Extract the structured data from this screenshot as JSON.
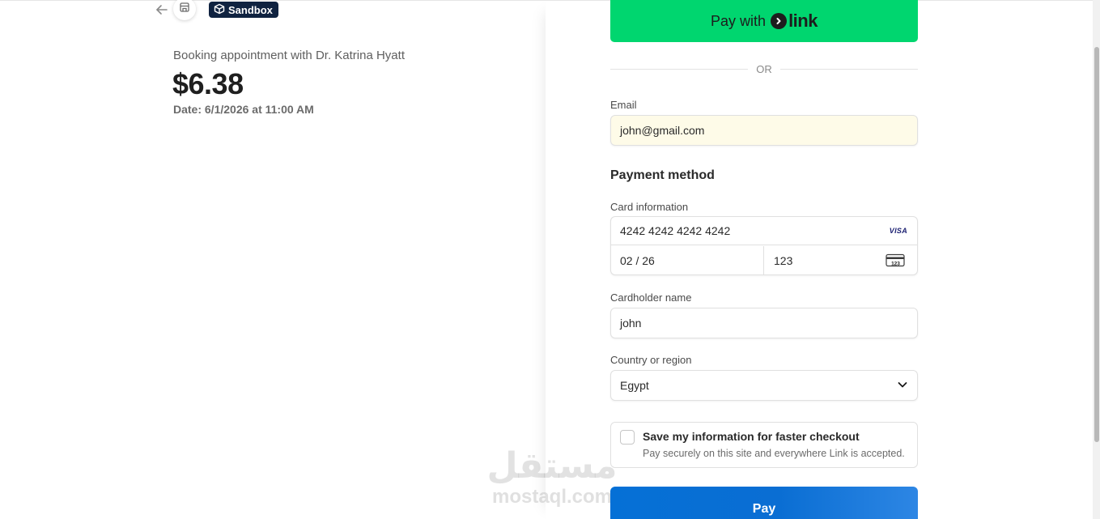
{
  "header": {
    "sandbox_label": "Sandbox"
  },
  "summary": {
    "product_name": "Booking appointment with Dr. Katrina Hyatt",
    "price": "$6.38",
    "date": "Date: 6/1/2026 at 11:00 AM"
  },
  "express": {
    "pay_with": "Pay with",
    "link_word": "link",
    "divider": "OR"
  },
  "contact": {
    "email_label": "Email",
    "email_value": "john@gmail.com"
  },
  "payment": {
    "section_title": "Payment method",
    "card_label": "Card information",
    "card_number": "4242 4242 4242 4242",
    "card_brand": "VISA",
    "expiry": "02 / 26",
    "cvc": "123",
    "cvc_icon_text": "123",
    "cardholder_label": "Cardholder name",
    "cardholder_value": "john",
    "country_label": "Country or region",
    "country_value": "Egypt"
  },
  "save_info": {
    "title": "Save my information for faster checkout",
    "subtitle": "Pay securely on this site and everywhere Link is accepted.",
    "checked": false
  },
  "pay_button": {
    "label": "Pay"
  },
  "watermark": {
    "arabic": "مستقل",
    "latin": "mostaql.com"
  },
  "icons": {
    "back": "arrow-left-icon",
    "store": "storefront-icon",
    "sandbox": "box-icon",
    "link": "chevron-right-icon",
    "cvc": "card-back-icon",
    "country": "chevron-down-icon"
  },
  "colors": {
    "link_green": "#00d66f",
    "pay_blue": "#0570d6",
    "sandbox_navy": "#0f2240",
    "email_autofill": "#fefbe8"
  }
}
